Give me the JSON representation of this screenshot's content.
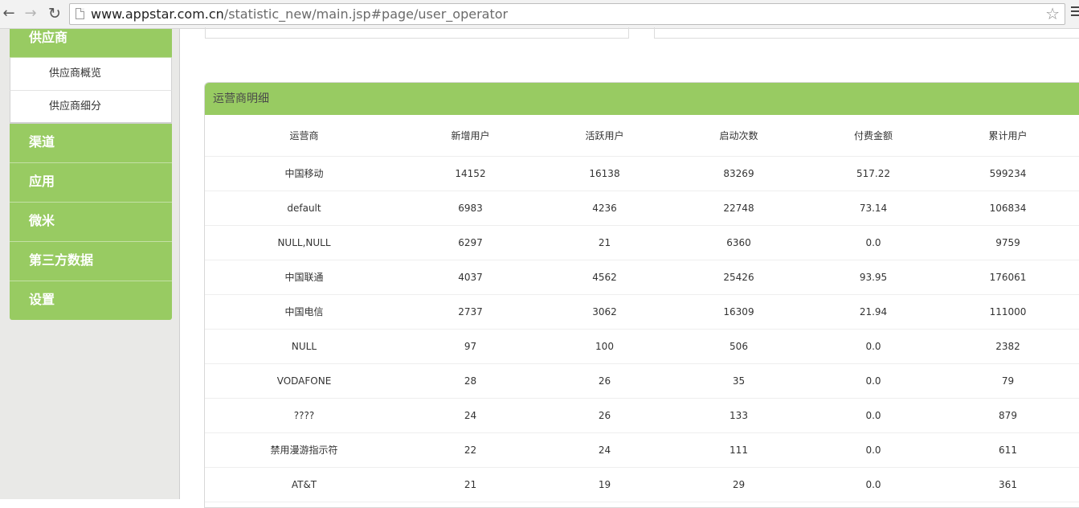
{
  "browser": {
    "url_host": "www.appstar.com.cn",
    "url_path": "/statistic_new/main.jsp#page/user_operator"
  },
  "sidebar": {
    "section_supplier": "供应商",
    "sub_items": [
      "供应商概览",
      "供应商细分"
    ],
    "sections": [
      "渠道",
      "应用",
      "微米",
      "第三方数据",
      "设置"
    ]
  },
  "panel": {
    "title": "运营商明细",
    "columns": [
      "运营商",
      "新增用户",
      "活跃用户",
      "启动次数",
      "付费金额",
      "累计用户"
    ],
    "rows": [
      [
        "中国移动",
        "14152",
        "16138",
        "83269",
        "517.22",
        "599234"
      ],
      [
        "default",
        "6983",
        "4236",
        "22748",
        "73.14",
        "106834"
      ],
      [
        "NULL,NULL",
        "6297",
        "21",
        "6360",
        "0.0",
        "9759"
      ],
      [
        "中国联通",
        "4037",
        "4562",
        "25426",
        "93.95",
        "176061"
      ],
      [
        "中国电信",
        "2737",
        "3062",
        "16309",
        "21.94",
        "111000"
      ],
      [
        "NULL",
        "97",
        "100",
        "506",
        "0.0",
        "2382"
      ],
      [
        "VODAFONE",
        "28",
        "26",
        "35",
        "0.0",
        "79"
      ],
      [
        "????",
        "24",
        "26",
        "133",
        "0.0",
        "879"
      ],
      [
        "禁用漫游指示符",
        "22",
        "24",
        "111",
        "0.0",
        "611"
      ],
      [
        "AT&T",
        "21",
        "19",
        "29",
        "0.0",
        "361"
      ]
    ]
  },
  "colors": {
    "accent": "#98cb62",
    "sidebar_bg": "#e9e9e7"
  }
}
